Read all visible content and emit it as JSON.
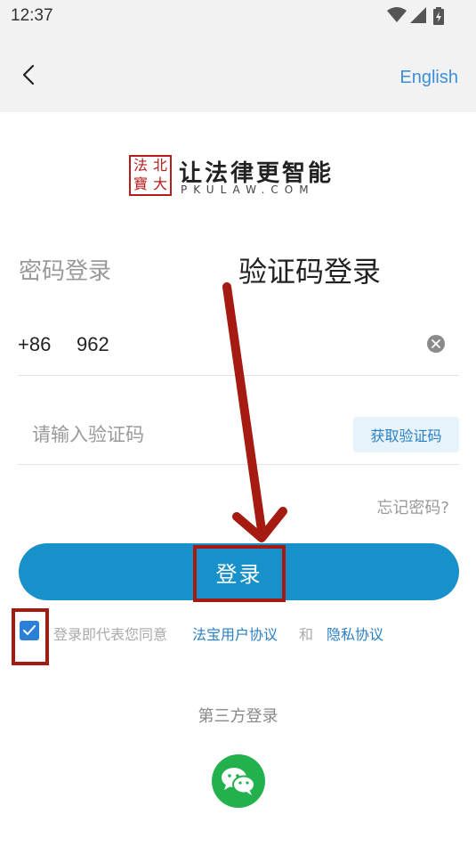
{
  "status_bar": {
    "time": "12:37",
    "icons": [
      "wifi-icon",
      "signal-icon",
      "battery-icon"
    ]
  },
  "header": {
    "back_icon": "chevron-left-icon",
    "language_label": "English"
  },
  "logo": {
    "seal_chars": [
      "法",
      "北",
      "寶",
      "大"
    ],
    "slogan": "让法律更智能",
    "domain": "PKULAW.COM"
  },
  "tabs": {
    "password_login": "密码登录",
    "code_login": "验证码登录"
  },
  "form": {
    "country_code": "+86",
    "phone_value": "962",
    "clear_icon": "clear-circle-icon",
    "code_placeholder": "请输入验证码",
    "code_value": "",
    "get_code_label": "获取验证码",
    "forgot_password": "忘记密码?"
  },
  "login_button": "登录",
  "agreement": {
    "checked": true,
    "prefix": "登录即代表您同意",
    "user_agreement": "法宝用户协议",
    "and": "和",
    "privacy_policy": "隐私协议"
  },
  "third_party": {
    "title": "第三方登录",
    "providers": [
      "wechat-icon"
    ]
  },
  "colors": {
    "primary": "#1890c9",
    "link": "#2a7fc4",
    "annotation": "#a51b12",
    "wechat": "#22b14c"
  }
}
